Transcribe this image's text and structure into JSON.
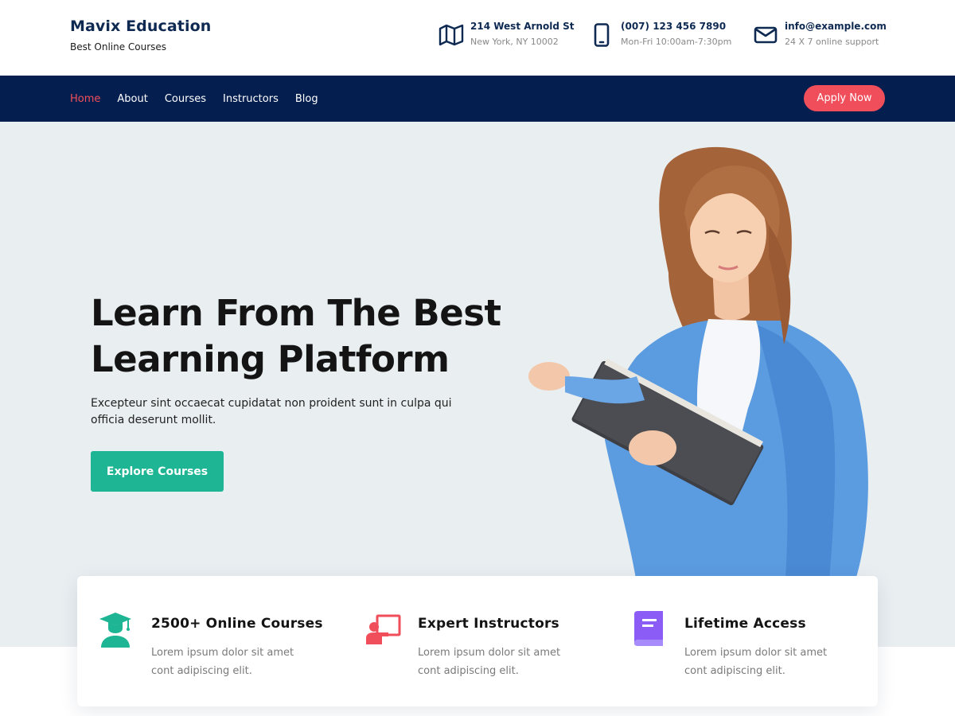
{
  "brand": {
    "title": "Mavix Education",
    "tagline": "Best Online Courses"
  },
  "contact": {
    "address": {
      "line1": "214 West Arnold St",
      "line2": "New York, NY 10002",
      "icon": "map-icon"
    },
    "phone": {
      "line1": "(007) 123 456 7890",
      "line2": "Mon-Fri 10:00am-7:30pm",
      "icon": "phone-icon"
    },
    "email": {
      "line1": "info@example.com",
      "line2": "24 X 7 online support",
      "icon": "envelope-icon"
    }
  },
  "nav": {
    "items": [
      {
        "label": "Home",
        "active": true
      },
      {
        "label": "About"
      },
      {
        "label": "Courses"
      },
      {
        "label": "Instructors"
      },
      {
        "label": "Blog"
      }
    ],
    "cta_label": "Apply Now"
  },
  "hero": {
    "heading_line1": "Learn From The Best",
    "heading_line2": "Learning Platform",
    "description": "Excepteur sint occaecat cupidatat non proident sunt in culpa qui officia deserunt mollit.",
    "cta_label": "Explore Courses",
    "image": "woman-reading-book-illustration"
  },
  "features": [
    {
      "title": "2500+ Online Courses",
      "desc_line1": "Lorem ipsum dolor sit amet",
      "desc_line2": "cont adipiscing elit.",
      "icon": "graduate-icon",
      "color": "#1db593"
    },
    {
      "title": "Expert Instructors",
      "desc_line1": "Lorem ipsum dolor sit amet",
      "desc_line2": "cont adipiscing elit.",
      "icon": "instructor-board-icon",
      "color": "#f04e5a"
    },
    {
      "title": "Lifetime Access",
      "desc_line1": "Lorem ipsum dolor sit amet",
      "desc_line2": "cont adipiscing elit.",
      "icon": "book-icon",
      "color": "#8b5cf6"
    }
  ],
  "colors": {
    "navy": "#041f4f",
    "accent_red": "#f04e5a",
    "accent_teal": "#1db593",
    "hero_bg": "#e9eef1"
  }
}
